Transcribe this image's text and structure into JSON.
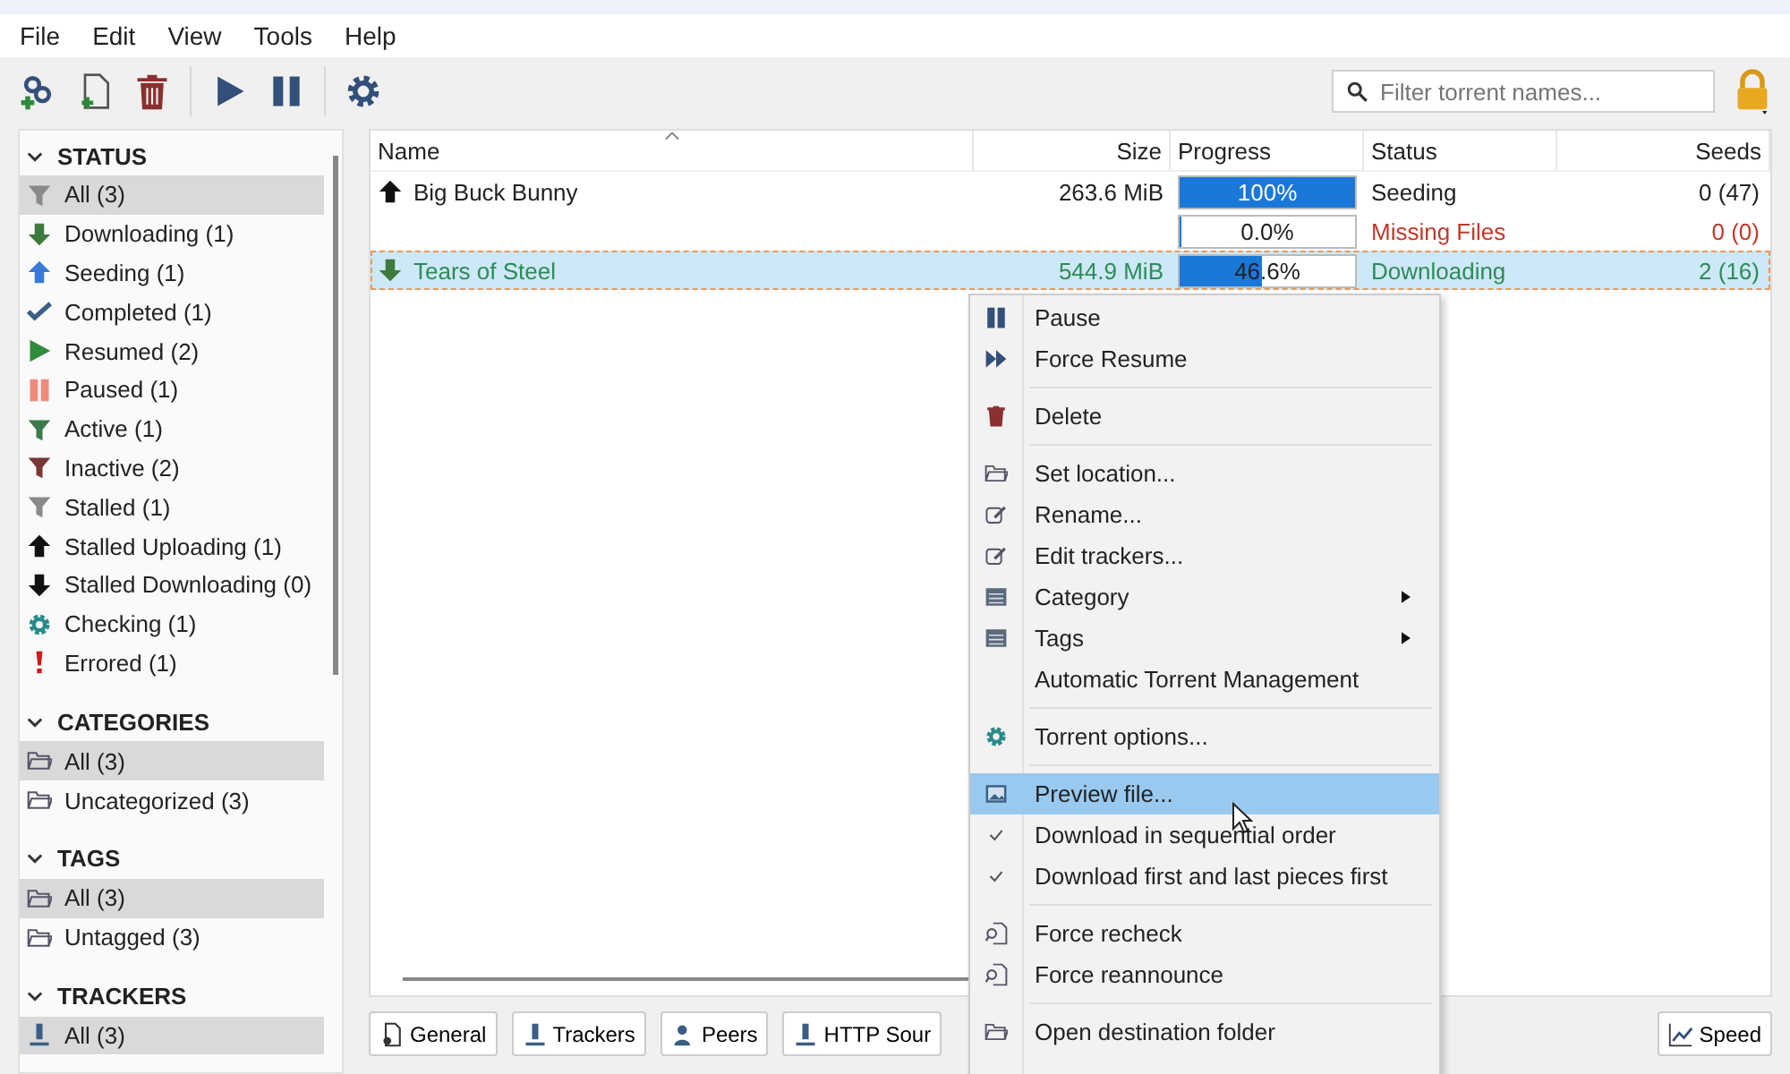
{
  "menu_bar": [
    "File",
    "Edit",
    "View",
    "Tools",
    "Help"
  ],
  "toolbar": {
    "search": {
      "placeholder": "Filter torrent names..."
    }
  },
  "sidebar": [
    {
      "heading": "STATUS",
      "expanded": true,
      "items": [
        {
          "label": "All (3)",
          "kind": "all",
          "selected": true
        },
        {
          "label": "Downloading (1)",
          "kind": "downloading",
          "selected": false
        },
        {
          "label": "Seeding (1)",
          "kind": "seeding",
          "selected": false
        },
        {
          "label": "Completed (1)",
          "kind": "completed",
          "selected": false
        },
        {
          "label": "Resumed (2)",
          "kind": "resumed",
          "selected": false
        },
        {
          "label": "Paused (1)",
          "kind": "paused",
          "selected": false
        },
        {
          "label": "Active (1)",
          "kind": "active",
          "selected": false
        },
        {
          "label": "Inactive (2)",
          "kind": "inactive",
          "selected": false
        },
        {
          "label": "Stalled (1)",
          "kind": "stalled",
          "selected": false
        },
        {
          "label": "Stalled Uploading (1)",
          "kind": "stalledup",
          "selected": false
        },
        {
          "label": "Stalled Downloading (0)",
          "kind": "stalleddown",
          "selected": false
        },
        {
          "label": "Checking (1)",
          "kind": "checking",
          "selected": false
        },
        {
          "label": "Errored (1)",
          "kind": "errored",
          "selected": false
        }
      ]
    },
    {
      "heading": "CATEGORIES",
      "expanded": true,
      "items": [
        {
          "label": "All (3)",
          "kind": "folder",
          "selected": true
        },
        {
          "label": "Uncategorized (3)",
          "kind": "folder",
          "selected": false
        }
      ]
    },
    {
      "heading": "TAGS",
      "expanded": true,
      "items": [
        {
          "label": "All (3)",
          "kind": "folder",
          "selected": true
        },
        {
          "label": "Untagged (3)",
          "kind": "folder",
          "selected": false
        }
      ]
    },
    {
      "heading": "TRACKERS",
      "expanded": true,
      "items": [
        {
          "label": "All (3)",
          "kind": "tracker",
          "selected": true
        }
      ]
    }
  ],
  "table": {
    "columns": [
      "Name",
      "Size",
      "Progress",
      "Status",
      "Seeds"
    ],
    "rows": [
      {
        "kind": "seeding",
        "name": "Big Buck Bunny",
        "size": "263.6 MiB",
        "level": 1,
        "progress": "100%",
        "status": "Seeding",
        "seeds": "0 (47)",
        "selected": false
      },
      {
        "kind": "missing",
        "level": 0,
        "progress": "0.0%",
        "status": "Missing Files",
        "seeds": "0 (0)",
        "selected": false
      },
      {
        "kind": "downloading",
        "name": "Tears of Steel",
        "size": "544.9 MiB",
        "level": 0.466,
        "progress": "46.6%",
        "status": "Downloading",
        "seeds": "2 (16)",
        "selected": true
      }
    ]
  },
  "detail_tabs": [
    {
      "label": "General",
      "kind": "general"
    },
    {
      "label": "Trackers",
      "kind": "trackers"
    },
    {
      "label": "Peers",
      "kind": "peers"
    },
    {
      "label": "HTTP Sour",
      "kind": "trackers"
    }
  ],
  "speed_button": "Speed",
  "context_menu": [
    {
      "kind": "pause",
      "label": "Pause",
      "submenu": false,
      "checked": false,
      "selected": false
    },
    {
      "kind": "resume",
      "label": "Force Resume",
      "submenu": false,
      "checked": false,
      "selected": false
    },
    {
      "kind": "separator"
    },
    {
      "kind": "delete",
      "label": "Delete",
      "submenu": false,
      "checked": false,
      "selected": false
    },
    {
      "kind": "separator"
    },
    {
      "kind": "location",
      "label": "Set location...",
      "submenu": false,
      "checked": false,
      "selected": false
    },
    {
      "kind": "edit",
      "label": "Rename...",
      "submenu": false,
      "checked": false,
      "selected": false
    },
    {
      "kind": "edit",
      "label": "Edit trackers...",
      "submenu": false,
      "checked": false,
      "selected": false
    },
    {
      "kind": "list",
      "label": "Category",
      "submenu": true,
      "checked": false,
      "selected": false
    },
    {
      "kind": "list",
      "label": "Tags",
      "submenu": true,
      "checked": false,
      "selected": false
    },
    {
      "kind": "plain",
      "label": "Automatic Torrent Management",
      "submenu": false,
      "checked": false,
      "selected": false
    },
    {
      "kind": "separator"
    },
    {
      "kind": "options",
      "label": "Torrent options...",
      "submenu": false,
      "checked": false,
      "selected": false
    },
    {
      "kind": "separator"
    },
    {
      "kind": "preview",
      "label": "Preview file...",
      "submenu": false,
      "checked": false,
      "selected": true
    },
    {
      "kind": "plain",
      "label": "Download in sequential order",
      "submenu": false,
      "checked": true,
      "selected": false
    },
    {
      "kind": "plain",
      "label": "Download first and last pieces first",
      "submenu": false,
      "checked": true,
      "selected": false
    },
    {
      "kind": "separator"
    },
    {
      "kind": "recheck",
      "label": "Force recheck",
      "submenu": false,
      "checked": false,
      "selected": false
    },
    {
      "kind": "recheck",
      "label": "Force reannounce",
      "submenu": false,
      "checked": false,
      "selected": false
    },
    {
      "kind": "separator"
    },
    {
      "kind": "location",
      "label": "Open destination folder",
      "submenu": false,
      "checked": false,
      "selected": false
    }
  ]
}
